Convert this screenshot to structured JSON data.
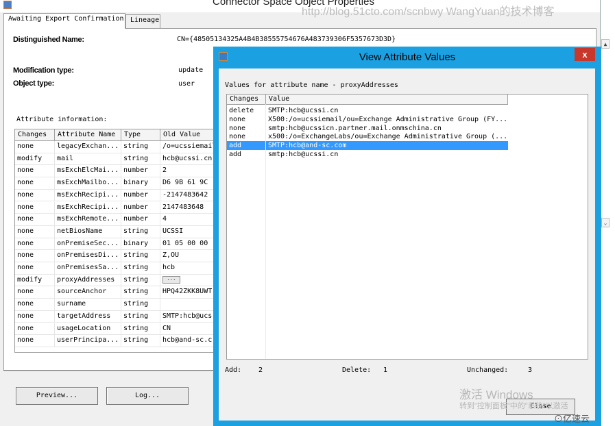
{
  "back_window": {
    "title": "Connector Space Object Properties",
    "watermark": "http://blog.51cto.com/scnbwy WangYuan的技术博客",
    "tabs": [
      {
        "label": "Awaiting Export Confirmation",
        "active": true
      },
      {
        "label": "Lineage",
        "active": false
      }
    ],
    "distinguished_name_label": "Distinguished Name:",
    "distinguished_name_value": "CN={48505134325A4B4B38555754676A483739306F5357673D3D}",
    "modification_type_label": "Modification type:",
    "modification_type_value": "update",
    "object_type_label": "Object type:",
    "object_type_value": "user",
    "attribute_info_label": "Attribute information:",
    "columns": [
      "Changes",
      "Attribute Name",
      "Type",
      "Old Value"
    ],
    "rows": [
      {
        "change": "none",
        "name": "legacyExchan...",
        "type": "string",
        "old": "/o=ucssiemail"
      },
      {
        "change": "modify",
        "name": "mail",
        "type": "string",
        "old": "hcb@ucssi.cn"
      },
      {
        "change": "none",
        "name": "msExchElcMai...",
        "type": "number",
        "old": "2"
      },
      {
        "change": "none",
        "name": "msExchMailbo...",
        "type": "binary",
        "old": "D6 9B 61 9C"
      },
      {
        "change": "none",
        "name": "msExchRecipi...",
        "type": "number",
        "old": "-2147483642"
      },
      {
        "change": "none",
        "name": "msExchRecipi...",
        "type": "number",
        "old": "2147483648"
      },
      {
        "change": "none",
        "name": "msExchRemote...",
        "type": "number",
        "old": "4"
      },
      {
        "change": "none",
        "name": "netBiosName",
        "type": "string",
        "old": "UCSSI"
      },
      {
        "change": "none",
        "name": "onPremiseSec...",
        "type": "binary",
        "old": "01 05 00 00"
      },
      {
        "change": "none",
        "name": "onPremisesDi...",
        "type": "string",
        "old": "Z,OU"
      },
      {
        "change": "none",
        "name": "onPremisesSa...",
        "type": "string",
        "old": "hcb"
      },
      {
        "change": "modify",
        "name": "proxyAddresses",
        "type": "string",
        "old": "..."
      },
      {
        "change": "none",
        "name": "sourceAnchor",
        "type": "string",
        "old": "HPQ42ZKK8UWT"
      },
      {
        "change": "none",
        "name": "surname",
        "type": "string",
        "old": ""
      },
      {
        "change": "none",
        "name": "targetAddress",
        "type": "string",
        "old": "SMTP:hcb@ucs"
      },
      {
        "change": "none",
        "name": "usageLocation",
        "type": "string",
        "old": "CN"
      },
      {
        "change": "none",
        "name": "userPrincipa...",
        "type": "string",
        "old": "hcb@and-sc.c"
      }
    ],
    "preview_button": "Preview...",
    "log_button": "Log..."
  },
  "dialog": {
    "title": "View Attribute Values",
    "close_glyph": "x",
    "values_label": "Values for attribute name - proxyAddresses",
    "columns": [
      "Changes",
      "Value"
    ],
    "rows": [
      {
        "change": "delete",
        "value": "SMTP:hcb@ucssi.cn",
        "selected": false
      },
      {
        "change": "none",
        "value": "X500:/o=ucssiemail/ou=Exchange Administrative Group (FY...",
        "selected": false
      },
      {
        "change": "none",
        "value": "smtp:hcb@ucssicn.partner.mail.onmschina.cn",
        "selected": false
      },
      {
        "change": "none",
        "value": "x500:/o=ExchangeLabs/ou=Exchange Administrative Group (...",
        "selected": false
      },
      {
        "change": "add",
        "value": "SMTP:hcb@and-sc.com",
        "selected": true
      },
      {
        "change": "add",
        "value": "smtp:hcb@ucssi.cn",
        "selected": false
      }
    ],
    "add_label": "Add:",
    "add_count": "2",
    "delete_label": "Delete:",
    "delete_count": "1",
    "unchanged_label": "Unchanged:",
    "unchanged_count": "3",
    "close_button": "Close"
  },
  "overlay": {
    "activate_title": "激活 Windows",
    "activate_sub": "转到\"控制面板\"中的\"系统\"以激活",
    "logo": "⊙亿速云"
  },
  "colors": {
    "dialog_frame": "#1ba0e1",
    "close_red": "#c8372b",
    "selection": "#3399ff"
  }
}
